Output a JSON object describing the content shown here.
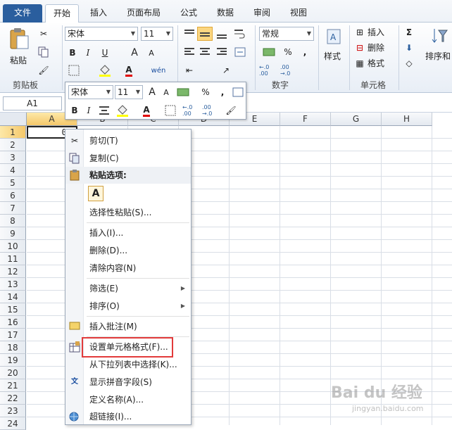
{
  "tabs": {
    "file": "文件",
    "home": "开始",
    "insert": "插入",
    "layout": "页面布局",
    "formula": "公式",
    "data": "数据",
    "review": "审阅",
    "view": "视图"
  },
  "ribbon": {
    "paste": "粘贴",
    "clipboard_label": "剪贴板",
    "font_name": "宋体",
    "font_size": "11",
    "bold": "B",
    "italic": "I",
    "underline": "U",
    "grow": "A",
    "shrink": "A",
    "font_color_letter": "A",
    "phonetic": "wén",
    "number_format": "常规",
    "percent": "%",
    "comma": ",",
    "inc_dec": "←.0 .00",
    "dec_dec": ".00 →.0",
    "number_label": "数字",
    "style": "样式",
    "insert": "插入",
    "delete": "删除",
    "format": "格式",
    "cells_label": "单元格",
    "sum": "Σ",
    "sort_filter": "排序和"
  },
  "mini": {
    "font_name": "宋体",
    "font_size": "11",
    "bold": "B",
    "italic": "I",
    "percent": "%",
    "comma": ","
  },
  "formula_bar": {
    "name_box": "A1"
  },
  "columns": [
    "A",
    "B",
    "C",
    "D",
    "E",
    "F",
    "G",
    "H"
  ],
  "rows": [
    "1",
    "2",
    "3",
    "4",
    "5",
    "6",
    "7",
    "8",
    "9",
    "10",
    "11",
    "12",
    "13",
    "14",
    "15",
    "16",
    "17",
    "18",
    "19",
    "20",
    "21",
    "22",
    "23",
    "24"
  ],
  "cell_a1": "0.",
  "context_menu": {
    "cut": "剪切(T)",
    "copy": "复制(C)",
    "paste_options": "粘贴选项:",
    "paste_special": "选择性粘贴(S)...",
    "insert": "插入(I)...",
    "delete": "删除(D)...",
    "clear": "清除内容(N)",
    "filter": "筛选(E)",
    "sort": "排序(O)",
    "insert_comment": "插入批注(M)",
    "format_cells": "设置单元格格式(F)...",
    "pick_list": "从下拉列表中选择(K)...",
    "phonetic": "显示拼音字段(S)",
    "define_name": "定义名称(A)...",
    "hyperlink": "超链接(I)..."
  },
  "watermark": {
    "main": "Bai du 经验",
    "sub": "jingyan.baidu.com"
  },
  "colors": {
    "accent": "#2a5e9e",
    "highlight_box": "#e23b3b"
  }
}
